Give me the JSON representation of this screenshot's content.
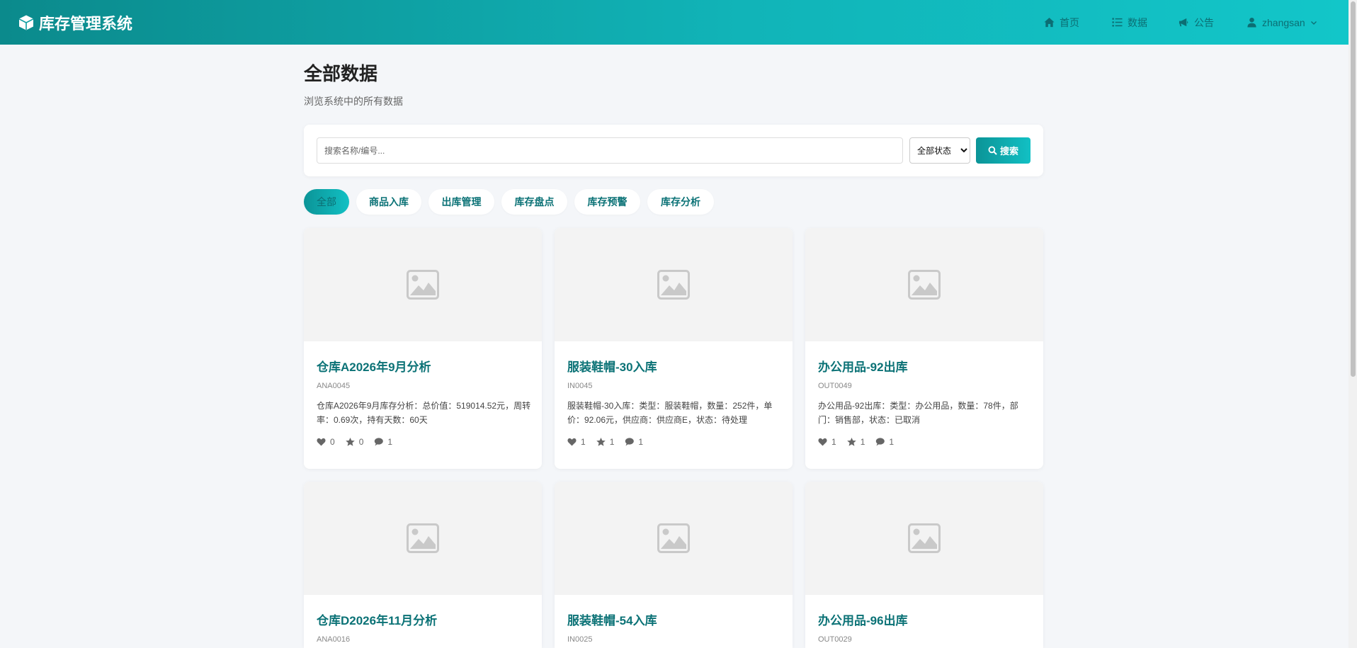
{
  "header": {
    "brand": "库存管理系统",
    "nav": {
      "home": "首页",
      "data": "数据",
      "notice": "公告",
      "user": "zhangsan"
    }
  },
  "page": {
    "title": "全部数据",
    "subtitle": "浏览系统中的所有数据"
  },
  "search": {
    "placeholder": "搜索名称/编号...",
    "status_selected": "全部状态",
    "button": "搜索"
  },
  "tabs": [
    {
      "label": "全部",
      "active": true
    },
    {
      "label": "商品入库",
      "active": false
    },
    {
      "label": "出库管理",
      "active": false
    },
    {
      "label": "库存盘点",
      "active": false
    },
    {
      "label": "库存预警",
      "active": false
    },
    {
      "label": "库存分析",
      "active": false
    }
  ],
  "cards": [
    {
      "title": "仓库A2026年9月分析",
      "code": "ANA0045",
      "desc": "仓库A2026年9月库存分析：总价值：519014.52元，周转率：0.69次，持有天数：60天",
      "likes": "0",
      "stars": "0",
      "comments": "1"
    },
    {
      "title": "服装鞋帽-30入库",
      "code": "IN0045",
      "desc": "服装鞋帽-30入库：类型：服装鞋帽，数量：252件，单价：92.06元，供应商：供应商E，状态：待处理",
      "likes": "1",
      "stars": "1",
      "comments": "1"
    },
    {
      "title": "办公用品-92出库",
      "code": "OUT0049",
      "desc": "办公用品-92出库：类型：办公用品，数量：78件，部门：销售部，状态：已取消",
      "likes": "1",
      "stars": "1",
      "comments": "1"
    },
    {
      "title": "仓库D2026年11月分析",
      "code": "ANA0016",
      "desc": "",
      "likes": "",
      "stars": "",
      "comments": ""
    },
    {
      "title": "服装鞋帽-54入库",
      "code": "IN0025",
      "desc": "",
      "likes": "",
      "stars": "",
      "comments": ""
    },
    {
      "title": "办公用品-96出库",
      "code": "OUT0029",
      "desc": "",
      "likes": "",
      "stars": "",
      "comments": ""
    }
  ],
  "colors": {
    "primary": "#0b9497",
    "accent": "#12c6c9",
    "title_text": "#0b7276"
  }
}
